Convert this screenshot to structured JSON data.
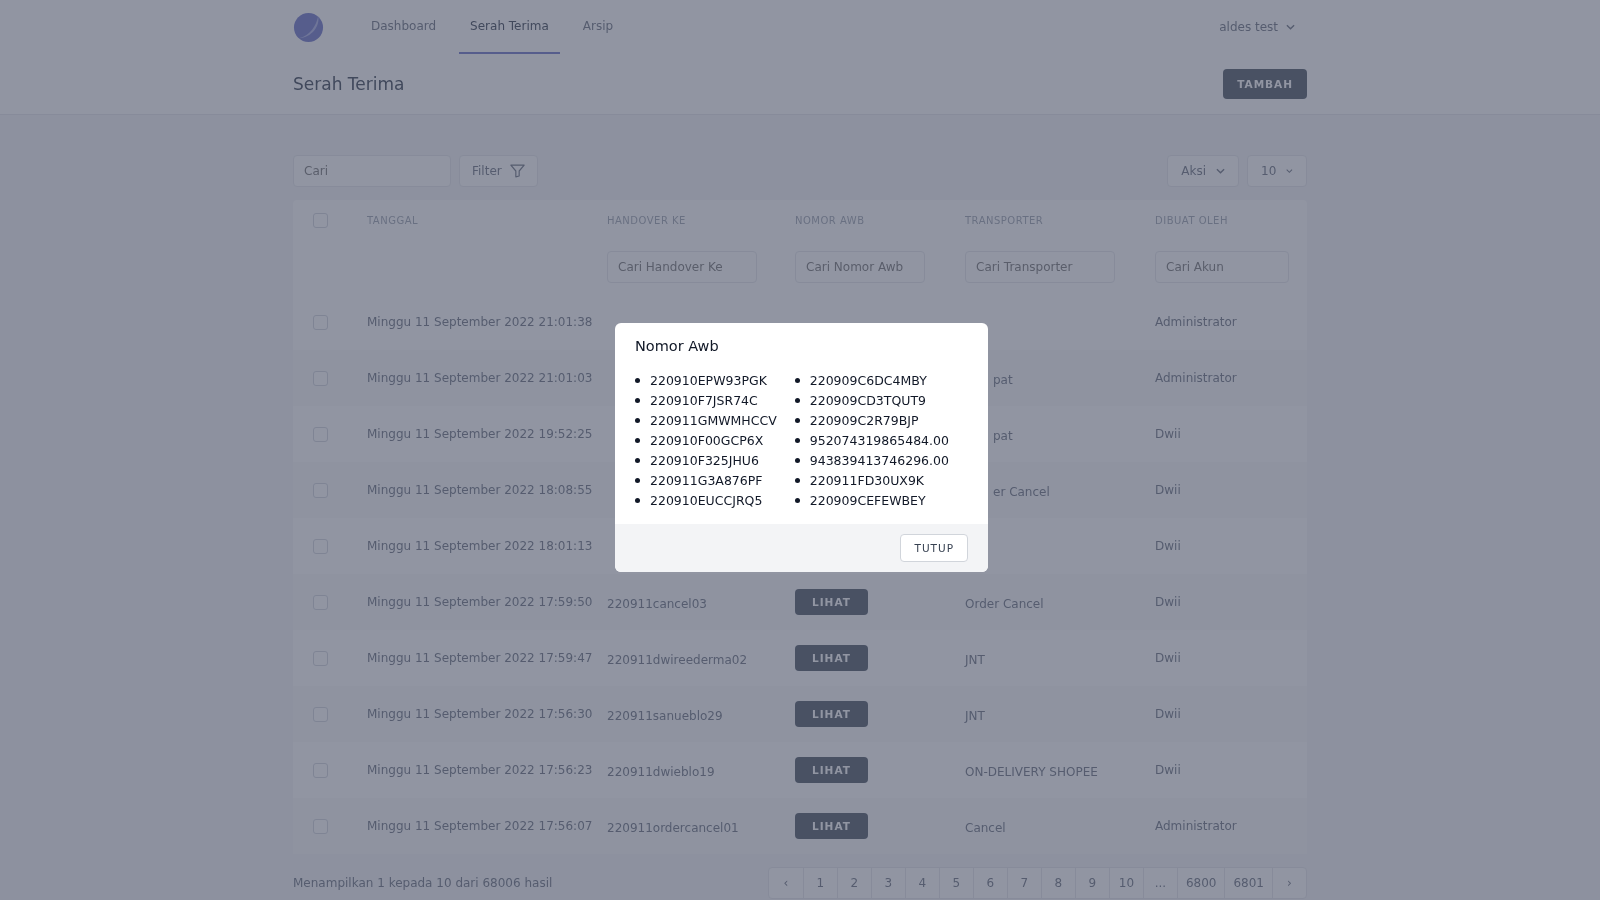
{
  "nav": {
    "tabs": [
      {
        "label": "Dashboard",
        "selected": false
      },
      {
        "label": "Serah Terima",
        "selected": true
      },
      {
        "label": "Arsip",
        "selected": false
      }
    ],
    "user": "aldes test"
  },
  "header": {
    "title": "Serah Terima",
    "add_button": "TAMBAH"
  },
  "toolbar": {
    "search_placeholder": "Cari",
    "filter_button": "Filter",
    "action_button": "Aksi",
    "page_size": "10"
  },
  "table": {
    "columns": [
      "TANGGAL",
      "HANDOVER KE",
      "NOMOR AWB",
      "TRANSPORTER",
      "DIBUAT OLEH"
    ],
    "all_checked": false,
    "column_filter_placeholders": [
      "Cari Handover Ke",
      "Cari Nomor Awb",
      "Cari Transporter",
      "Cari Akun"
    ],
    "rows": [
      {
        "checked": false,
        "date": "Minggu 11 September 2022 21:01:38",
        "created_by": "Administrator"
      },
      {
        "checked": false,
        "date": "Minggu 11 September 2022 21:01:03",
        "transporter": "pat",
        "created_by": "Administrator"
      },
      {
        "checked": false,
        "date": "Minggu 11 September 2022 19:52:25",
        "transporter": "pat",
        "created_by": "Dwii"
      },
      {
        "checked": false,
        "date": "Minggu 11 September 2022 18:08:55",
        "transporter": "er Cancel",
        "created_by": "Dwii"
      },
      {
        "checked": false,
        "date": "Minggu 11 September 2022 18:01:13",
        "created_by": "Dwii"
      },
      {
        "checked": false,
        "date": "Minggu 11 September 2022 17:59:50",
        "handover": "220911cancel03",
        "awb_button": "LIHAT",
        "transporter": "Order Cancel",
        "created_by": "Dwii"
      },
      {
        "checked": false,
        "date": "Minggu 11 September 2022 17:59:47",
        "handover": "220911dwireederma02",
        "awb_button": "LIHAT",
        "transporter": "JNT",
        "created_by": "Dwii"
      },
      {
        "checked": false,
        "date": "Minggu 11 September 2022 17:56:30",
        "handover": "220911sanueblo29",
        "awb_button": "LIHAT",
        "transporter": "JNT",
        "created_by": "Dwii"
      },
      {
        "checked": false,
        "date": "Minggu 11 September 2022 17:56:23",
        "handover": "220911dwieblo19",
        "awb_button": "LIHAT",
        "transporter": "ON-DELIVERY SHOPEE",
        "created_by": "Dwii"
      },
      {
        "checked": false,
        "date": "Minggu 11 September 2022 17:56:07",
        "handover": "220911ordercancel01",
        "awb_button": "LIHAT",
        "transporter": "Cancel",
        "created_by": "Administrator"
      }
    ]
  },
  "footer": {
    "summary": "Menampilkan 1 kepada 10 dari 68006 hasil",
    "prev": "‹",
    "pages": [
      "1",
      "2",
      "3",
      "4",
      "5",
      "6",
      "7",
      "8",
      "9",
      "10",
      "...",
      "6800",
      "6801"
    ],
    "next": "›"
  },
  "modal": {
    "title": "Nomor Awb",
    "column_1": [
      "220910EPW93PGK",
      "220910F7JSR74C",
      "220911GMWMHCCV",
      "220910F00GCP6X",
      "220910F325JHU6",
      "220911G3A876PF",
      "220910EUCCJRQ5"
    ],
    "column_2": [
      "220909C6DC4MBY",
      "220909CD3TQUT9",
      "220909C2R79BJP",
      "952074319865484.00",
      "943839413746296.00",
      "220911FD30UX9K",
      "220909CEFEWBEY"
    ],
    "close_button": "TUTUP"
  }
}
